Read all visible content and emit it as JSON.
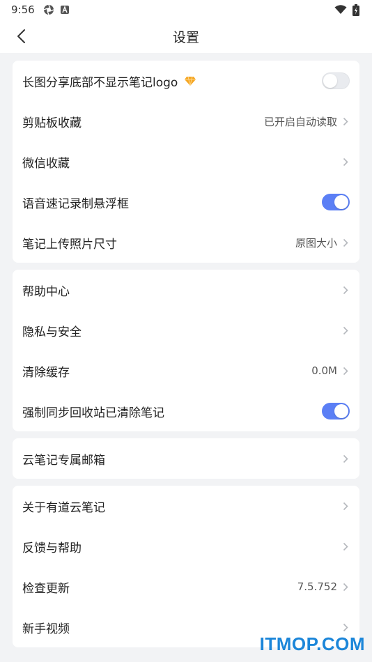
{
  "status_bar": {
    "time": "9:56"
  },
  "nav": {
    "title": "设置",
    "back_icon": "chevron-left-icon"
  },
  "groups": [
    {
      "rows": [
        {
          "label": "长图分享底部不显示笔记logo",
          "control": "toggle",
          "on": false,
          "badge_icon": "gem-icon"
        },
        {
          "label": "剪贴板收藏",
          "value": "已开启自动读取",
          "control": "chevron"
        },
        {
          "label": "微信收藏",
          "value": "",
          "control": "chevron"
        },
        {
          "label": "语音速记录制悬浮框",
          "control": "toggle",
          "on": true
        },
        {
          "label": "笔记上传照片尺寸",
          "value": "原图大小",
          "control": "chevron"
        }
      ]
    },
    {
      "rows": [
        {
          "label": "帮助中心",
          "value": "",
          "control": "chevron"
        },
        {
          "label": "隐私与安全",
          "value": "",
          "control": "chevron"
        },
        {
          "label": "清除缓存",
          "value": "0.0M",
          "control": "chevron"
        },
        {
          "label": "强制同步回收站已清除笔记",
          "control": "toggle",
          "on": true
        }
      ]
    },
    {
      "rows": [
        {
          "label": "云笔记专属邮箱",
          "value": "",
          "control": "chevron"
        }
      ]
    },
    {
      "rows": [
        {
          "label": "关于有道云笔记",
          "value": "",
          "control": "chevron"
        },
        {
          "label": "反馈与帮助",
          "value": "",
          "control": "chevron"
        },
        {
          "label": "检查更新",
          "value": "7.5.752",
          "control": "chevron"
        },
        {
          "label": "新手视频",
          "value": "",
          "control": "chevron"
        }
      ]
    }
  ],
  "watermark": "ITMOP.COM",
  "colors": {
    "accent": "#5b7ff5",
    "background": "#f2f3f5",
    "gem": "#f5a623",
    "watermark": "#1c86d9"
  }
}
